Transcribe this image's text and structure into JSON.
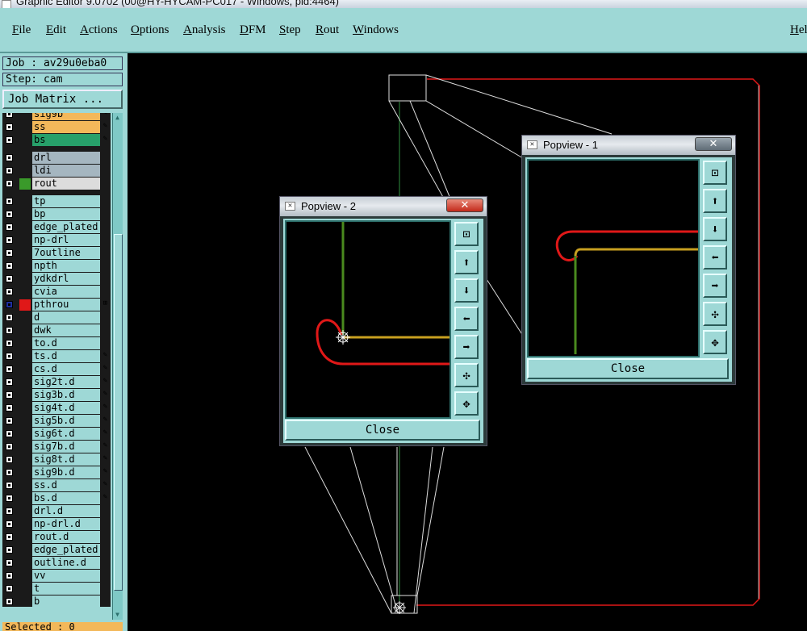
{
  "window": {
    "title": "Graphic Editor 9.0702 (00@HY-HYCAM-PC017 - Windows, pid:4464)"
  },
  "menu": [
    "File",
    "Edit",
    "Actions",
    "Options",
    "Analysis",
    "DFM",
    "Step",
    "Rout",
    "Windows"
  ],
  "menu_right": "Hel",
  "job": {
    "label": "Job : av29u0eba0",
    "step": "Step: cam",
    "matrix_button": "Job Matrix ..."
  },
  "layers": [
    {
      "name": "sig9b",
      "color": "#f3b85a",
      "flag": "✎"
    },
    {
      "name": "ss",
      "color": "#f3b85a",
      "flag": "✎"
    },
    {
      "name": "bs",
      "color": "#27a06a",
      "flag": "✎"
    },
    {
      "name": "drl",
      "color": "#a5b6c0",
      "flag": ""
    },
    {
      "name": "ldi",
      "color": "#a5b6c0",
      "flag": ""
    },
    {
      "name": "rout",
      "color": "#dcdcdc",
      "flag": ""
    },
    {
      "name": "tp",
      "color": "#9ed8d6",
      "flag": ""
    },
    {
      "name": "bp",
      "color": "#9ed8d6",
      "flag": ""
    },
    {
      "name": "edge_plated",
      "color": "#9ed8d6",
      "flag": ""
    },
    {
      "name": "np-drl",
      "color": "#9ed8d6",
      "flag": ""
    },
    {
      "name": "7outline",
      "color": "#9ed8d6",
      "flag": ""
    },
    {
      "name": "npth",
      "color": "#9ed8d6",
      "flag": ""
    },
    {
      "name": "ydkdrl",
      "color": "#9ed8d6",
      "flag": ""
    },
    {
      "name": "cvia",
      "color": "#9ed8d6",
      "flag": ""
    },
    {
      "name": "pthrou",
      "color": "#9ed8d6",
      "flag": "⊞"
    },
    {
      "name": "d",
      "color": "#9ed8d6",
      "flag": ""
    },
    {
      "name": "dwk",
      "color": "#9ed8d6",
      "flag": ""
    },
    {
      "name": "to.d",
      "color": "#9ed8d6",
      "flag": ""
    },
    {
      "name": "ts.d",
      "color": "#9ed8d6",
      "flag": "✎"
    },
    {
      "name": "cs.d",
      "color": "#9ed8d6",
      "flag": "✎"
    },
    {
      "name": "sig2t.d",
      "color": "#9ed8d6",
      "flag": "✎"
    },
    {
      "name": "sig3b.d",
      "color": "#9ed8d6",
      "flag": "✎"
    },
    {
      "name": "sig4t.d",
      "color": "#9ed8d6",
      "flag": "✎"
    },
    {
      "name": "sig5b.d",
      "color": "#9ed8d6",
      "flag": "✎"
    },
    {
      "name": "sig6t.d",
      "color": "#9ed8d6",
      "flag": "✎"
    },
    {
      "name": "sig7b.d",
      "color": "#9ed8d6",
      "flag": "✎"
    },
    {
      "name": "sig8t.d",
      "color": "#9ed8d6",
      "flag": "✎"
    },
    {
      "name": "sig9b.d",
      "color": "#9ed8d6",
      "flag": "✎"
    },
    {
      "name": "ss.d",
      "color": "#9ed8d6",
      "flag": "✎"
    },
    {
      "name": "bs.d",
      "color": "#9ed8d6",
      "flag": "✎"
    },
    {
      "name": "drl.d",
      "color": "#9ed8d6",
      "flag": ""
    },
    {
      "name": "np-drl.d",
      "color": "#9ed8d6",
      "flag": ""
    },
    {
      "name": "rout.d",
      "color": "#9ed8d6",
      "flag": ""
    },
    {
      "name": "edge_plated",
      "color": "#9ed8d6",
      "flag": ""
    },
    {
      "name": "outline.d",
      "color": "#9ed8d6",
      "flag": ""
    },
    {
      "name": "vv",
      "color": "#9ed8d6",
      "flag": ""
    },
    {
      "name": "t",
      "color": "#9ed8d6",
      "flag": ""
    },
    {
      "name": "b",
      "color": "#9ed8d6",
      "flag": ""
    }
  ],
  "status": {
    "selected": "Selected : 0"
  },
  "popview1": {
    "title": "Popview - 1",
    "close": "Close"
  },
  "popview2": {
    "title": "Popview - 2",
    "close": "Close"
  },
  "colors": {
    "panel": "#9ed8d6",
    "trace_red": "#e01818",
    "trace_green": "#4a8a1e",
    "trace_gold": "#c8a020",
    "profile": "#3a9a3a"
  }
}
